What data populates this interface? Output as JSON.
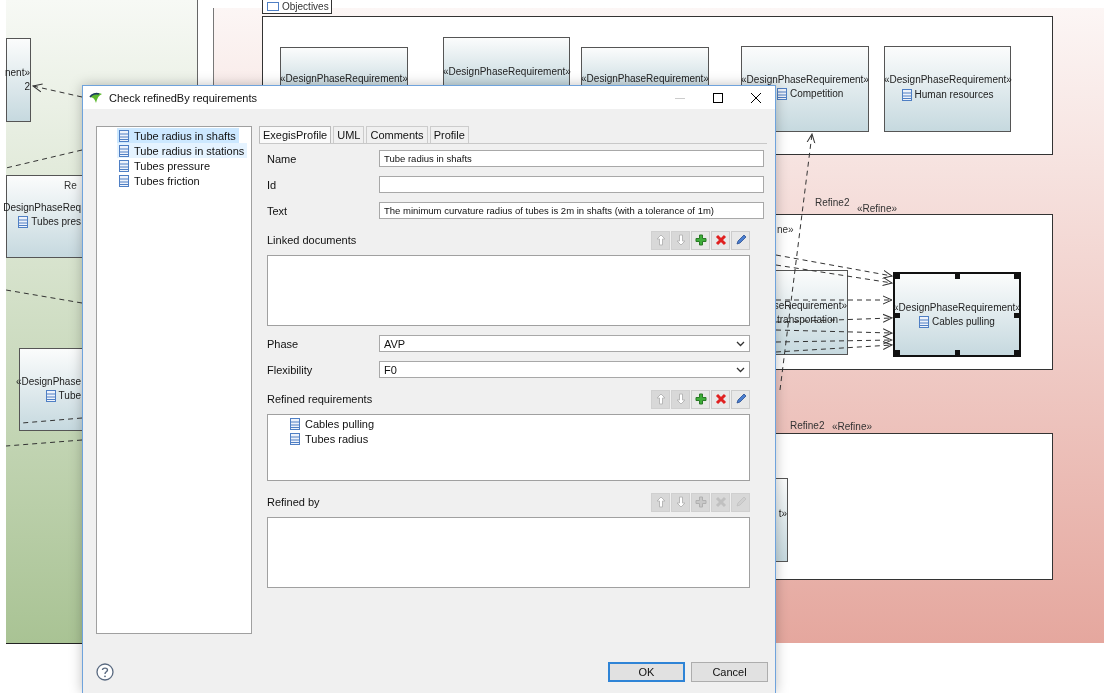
{
  "diagram": {
    "frame_tab": "Objectives",
    "nodes": [
      {
        "stereotype": "nent»",
        "name": "2",
        "icon": false,
        "selected": false
      },
      {
        "stereotype": "DesignPhaseReq",
        "name": "Tubes pres",
        "icon": true,
        "selected": false
      },
      {
        "stereotype": "«DesignPhase",
        "name": "Tube",
        "icon": true,
        "selected": false
      },
      {
        "stereotype": "«DesignPhaseRequirement»",
        "selected": false
      },
      {
        "stereotype": "«DesignPhaseRequirement»",
        "selected": false
      },
      {
        "stereotype": "«DesignPhaseRequirement»",
        "selected": false
      },
      {
        "stereotype": "«DesignPhaseRequirement»",
        "name": "Competition",
        "icon": true,
        "selected": false
      },
      {
        "stereotype": "«DesignPhaseRequirement»",
        "name": "Human resources",
        "icon": true,
        "selected": false
      },
      {
        "stereotype": "seRequirement»",
        "name": "transportation",
        "icon": false,
        "selected": false
      },
      {
        "stereotype": "«DesignPhaseRequirement»",
        "name": "Cables pulling",
        "icon": true,
        "selected": true
      },
      {
        "stereotype": "t»",
        "selected": false
      }
    ],
    "labels": [
      "Re",
      "ne»",
      "Refine2",
      "«Refine»",
      "Refine2",
      "«Refine»"
    ]
  },
  "dialog": {
    "title": "Check refinedBy requirements",
    "window_controls": [
      {
        "kind": "minimize",
        "enabled": false
      },
      {
        "kind": "maximize",
        "enabled": true
      },
      {
        "kind": "close",
        "enabled": true
      }
    ],
    "tree": [
      {
        "label": "Tube radius in shafts",
        "selected": true,
        "hovered": false
      },
      {
        "label": "Tube radius in stations",
        "selected": false,
        "hovered": true
      },
      {
        "label": "Tubes pressure",
        "selected": false,
        "hovered": false
      },
      {
        "label": "Tubes friction",
        "selected": false,
        "hovered": false
      }
    ],
    "tabs": [
      {
        "label": "ExegisProfile",
        "selected": true
      },
      {
        "label": "UML",
        "selected": false
      },
      {
        "label": "Comments",
        "selected": false
      },
      {
        "label": "Profile",
        "selected": false
      }
    ],
    "fields": [
      {
        "kind": "text",
        "label": "Name",
        "value": "Tube radius in shafts"
      },
      {
        "kind": "text",
        "label": "Id"
      },
      {
        "kind": "text",
        "label": "Text",
        "value": "The minimum curvature radius of tubes is 2m in shafts (with a tolerance of 1m)"
      },
      {
        "kind": "list",
        "label": "Linked documents",
        "actions": [
          {
            "kind": "up",
            "enabled": false
          },
          {
            "kind": "down",
            "enabled": false
          },
          {
            "kind": "add",
            "enabled": true
          },
          {
            "kind": "delete",
            "enabled": true
          },
          {
            "kind": "edit",
            "enabled": true
          }
        ]
      },
      {
        "kind": "combo",
        "label": "Phase",
        "value": "AVP"
      },
      {
        "kind": "combo",
        "label": "Flexibility",
        "value": "F0"
      },
      {
        "kind": "list",
        "label": "Refined requirements",
        "actions": [
          {
            "kind": "up",
            "enabled": false
          },
          {
            "kind": "down",
            "enabled": false
          },
          {
            "kind": "add",
            "enabled": true
          },
          {
            "kind": "delete",
            "enabled": true
          },
          {
            "kind": "edit",
            "enabled": true
          }
        ],
        "items": [
          "Cables pulling",
          "Tubes radius"
        ]
      },
      {
        "kind": "list",
        "label": "Refined by",
        "actions": [
          {
            "kind": "up",
            "enabled": false
          },
          {
            "kind": "down",
            "enabled": false
          },
          {
            "kind": "add",
            "enabled": false
          },
          {
            "kind": "delete",
            "enabled": false
          },
          {
            "kind": "edit",
            "enabled": false
          }
        ]
      }
    ],
    "buttons": [
      {
        "label": "OK",
        "default": true
      },
      {
        "label": "Cancel",
        "default": false
      }
    ]
  }
}
